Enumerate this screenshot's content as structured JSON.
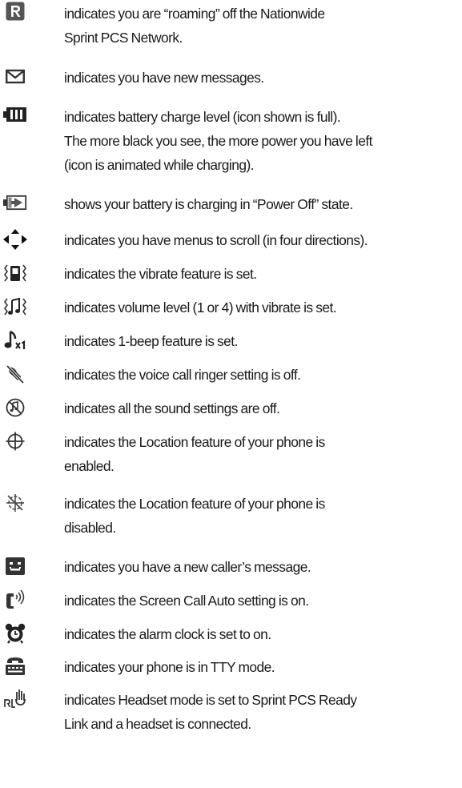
{
  "items": [
    {
      "icon": "roaming-r-icon",
      "lines": [
        "indicates you are “roaming” off the Nationwide",
        "Sprint PCS Network."
      ]
    },
    {
      "icon": "envelope-icon",
      "lines": [
        "indicates you have new messages."
      ]
    },
    {
      "icon": "battery-full-icon",
      "lines": [
        "indicates battery charge level (icon shown is full).",
        "The more black you see, the more power you have left",
        "(icon is animated while charging)."
      ]
    },
    {
      "icon": "battery-charging-icon",
      "lines": [
        "shows your battery is charging in “Power Off” state."
      ]
    },
    {
      "icon": "four-way-scroll-icon",
      "lines": [
        "indicates you have menus to scroll (in four directions)."
      ]
    },
    {
      "icon": "vibrate-icon",
      "lines": [
        "indicates the vibrate feature is set."
      ]
    },
    {
      "icon": "volume-vibrate-icon",
      "lines": [
        "indicates volume level (1 or 4) with vibrate is set."
      ]
    },
    {
      "icon": "one-beep-icon",
      "lines": [
        "indicates 1-beep feature is set."
      ]
    },
    {
      "icon": "ringer-off-icon",
      "lines": [
        "indicates the voice call ringer setting is off."
      ]
    },
    {
      "icon": "all-sounds-off-icon",
      "lines": [
        "indicates all the sound settings are off."
      ]
    },
    {
      "icon": "location-on-icon",
      "lines": [
        "indicates the Location feature of your phone is",
        "enabled."
      ]
    },
    {
      "icon": "location-off-icon",
      "lines": [
        "indicates the Location feature of your phone is",
        "disabled."
      ]
    },
    {
      "icon": "caller-message-icon",
      "lines": [
        "indicates you have a new caller’s message."
      ]
    },
    {
      "icon": "screen-call-icon",
      "lines": [
        "indicates the Screen Call Auto setting is on."
      ]
    },
    {
      "icon": "alarm-clock-icon",
      "lines": [
        "indicates the alarm clock is set to on."
      ]
    },
    {
      "icon": "tty-icon",
      "lines": [
        "indicates your phone is in TTY mode."
      ]
    },
    {
      "icon": "headset-readylink-icon",
      "lines": [
        "indicates Headset mode is set to Sprint PCS Ready",
        "Link and a headset is connected."
      ]
    }
  ]
}
